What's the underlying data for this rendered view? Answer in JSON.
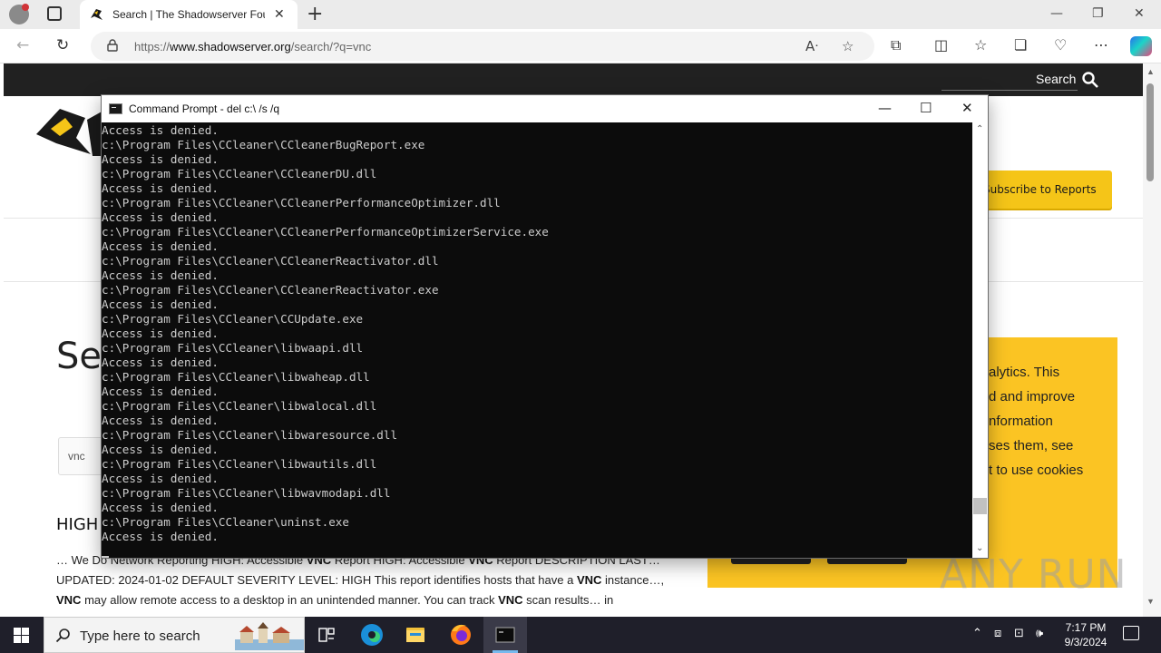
{
  "browser": {
    "tab_title": "Search | The Shadowserver Foundation",
    "url_prefix": "https://",
    "url_domain": "www.shadowserver.org",
    "url_path": "/search/?q=vnc",
    "new_tab_symbol": "+",
    "close_symbol": "✕"
  },
  "page": {
    "site_search_label": "Search",
    "subscribe_label": "Subscribe to Reports",
    "heading_visible": "Se",
    "search_value": "vnc",
    "result_title_visible": "HIGH",
    "result_lines": [
      "… We Do Network Reporting HIGH: Accessible VNC Report HIGH: Accessible VNC Report DESCRIPTION LAST…",
      "UPDATED: 2024-01-02 DEFAULT SEVERITY LEVEL: HIGH This report identifies hosts that have a VNC instance…,",
      "VNC may allow remote access to a desktop in an unintended manner. You can track VNC scan results… in"
    ],
    "cookie_lines": [
      "alytics. This",
      "d and improve",
      "nformation",
      "ses them, see",
      "t to use cookies"
    ]
  },
  "cmd": {
    "title": "Command Prompt - del  c:\\ /s /q",
    "lines": [
      "Access is denied.",
      "c:\\Program Files\\CCleaner\\CCleanerBugReport.exe",
      "Access is denied.",
      "c:\\Program Files\\CCleaner\\CCleanerDU.dll",
      "Access is denied.",
      "c:\\Program Files\\CCleaner\\CCleanerPerformanceOptimizer.dll",
      "Access is denied.",
      "c:\\Program Files\\CCleaner\\CCleanerPerformanceOptimizerService.exe",
      "Access is denied.",
      "c:\\Program Files\\CCleaner\\CCleanerReactivator.dll",
      "Access is denied.",
      "c:\\Program Files\\CCleaner\\CCleanerReactivator.exe",
      "Access is denied.",
      "c:\\Program Files\\CCleaner\\CCUpdate.exe",
      "Access is denied.",
      "c:\\Program Files\\CCleaner\\libwaapi.dll",
      "Access is denied.",
      "c:\\Program Files\\CCleaner\\libwaheap.dll",
      "Access is denied.",
      "c:\\Program Files\\CCleaner\\libwalocal.dll",
      "Access is denied.",
      "c:\\Program Files\\CCleaner\\libwaresource.dll",
      "Access is denied.",
      "c:\\Program Files\\CCleaner\\libwautils.dll",
      "Access is denied.",
      "c:\\Program Files\\CCleaner\\libwavmodapi.dll",
      "Access is denied.",
      "c:\\Program Files\\CCleaner\\uninst.exe",
      "Access is denied."
    ]
  },
  "taskbar": {
    "search_placeholder": "Type here to search",
    "time": "7:17 PM",
    "date": "9/3/2024"
  },
  "watermark": "ANY RUN",
  "icons": {
    "site_accent": "#fbc423",
    "taskbar_bg": "#1f1f2a",
    "console_bg": "#0c0c0c"
  }
}
